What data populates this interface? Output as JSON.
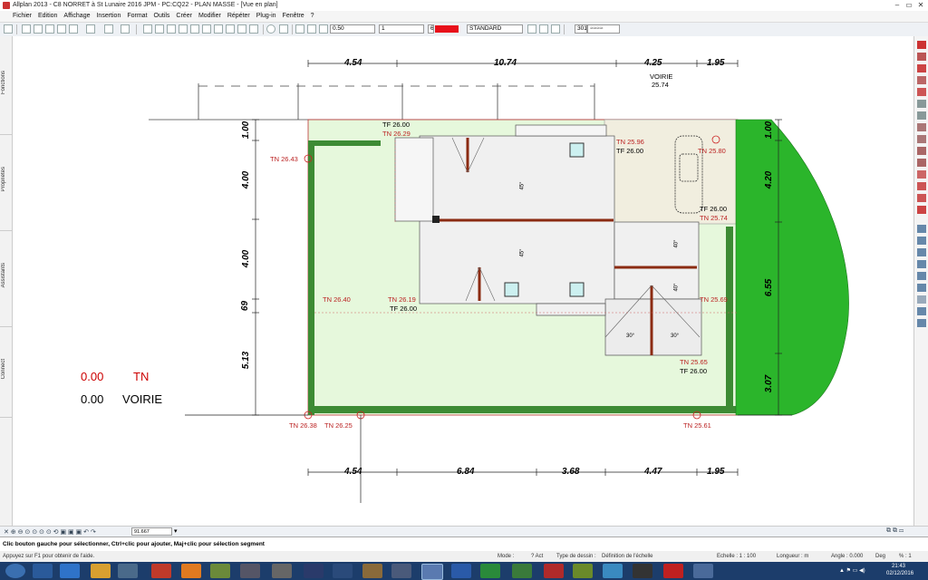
{
  "window": {
    "title": "Allplan 2013 - C8 NORRET à St Lunaire 2016 JPM - PC:CQ22 - PLAN MASSE - [Vue en plan]",
    "controls": [
      "–",
      "▭",
      "✕"
    ]
  },
  "menu": [
    "Fichier",
    "Edition",
    "Affichage",
    "Insertion",
    "Format",
    "Outils",
    "Créer",
    "Modifier",
    "Répéter",
    "Plug-in",
    "Fenêtre",
    "?"
  ],
  "toolbar": {
    "pen": "0.50",
    "line": "1",
    "color_index": "6",
    "color_swatch": "#e8101a",
    "layer": "STANDARD",
    "hatch": "301"
  },
  "left_tabs": [
    "Fonctions",
    "Propriétés",
    "Assistants",
    "Connect"
  ],
  "plan": {
    "dims_top": [
      "4.54",
      "10.74",
      "4.25",
      "1.95"
    ],
    "dims_bottom": [
      "4.54",
      "6.84",
      "3.68",
      "4.47",
      "1.95"
    ],
    "dims_left": [
      "1.00",
      "4.00",
      "4.00",
      "69",
      "5.13"
    ],
    "dims_right": [
      "1.00",
      "4.20",
      "6.55",
      "3.07"
    ],
    "voirie_top": [
      "VOIRIE",
      "25.74"
    ],
    "labels": {
      "tf_top": "TF 26.00",
      "tn_top": "TN 26.29",
      "tn_2596": "TN 25.96",
      "tf_2600b": "TF 26.00",
      "tn_2580": "TN 25.80",
      "tn_2643": "TN 26.43",
      "tf_right": "TF 26.00",
      "tn_2574": "TN 25.74",
      "tn_2640": "TN 26.40",
      "tn_2619": "TN 26.19",
      "tf_mid": "TF 26.00",
      "tn_2569": "TN 25.69",
      "tn_2565": "TN 25.65",
      "tf_bottom": "TF 26.00",
      "tn_2638": "TN 26.38",
      "tn_2625": "TN 26.25",
      "tn_2561": "TN 25.61"
    },
    "roof_slopes": [
      "45°",
      "45°",
      "40°",
      "40°",
      "30°",
      "30°"
    ],
    "legend": [
      {
        "value": "0.00",
        "label": "TN"
      },
      {
        "value": "0.00",
        "label": "VOIRIE"
      }
    ]
  },
  "bottom_tools": {
    "scale_field": "91.667"
  },
  "prompt": "Clic bouton gauche pour sélectionner, Ctrl+clic pour ajouter, Maj+clic pour sélection segment",
  "status": {
    "help": "Appuyez sur F1 pour obtenir de l'aide.",
    "mode": "Mode :",
    "mode_val": "? Act",
    "type": "Type de dessin :",
    "type_val": "Définition de l'échelle",
    "echelle": "Echelle : 1 : 100",
    "longueur": "Longueur : m",
    "angle": "Angle : 0.000",
    "deg": "Deg",
    "pct": "% : 1"
  },
  "taskbar": {
    "time": "21:43",
    "date": "02/12/2016"
  }
}
